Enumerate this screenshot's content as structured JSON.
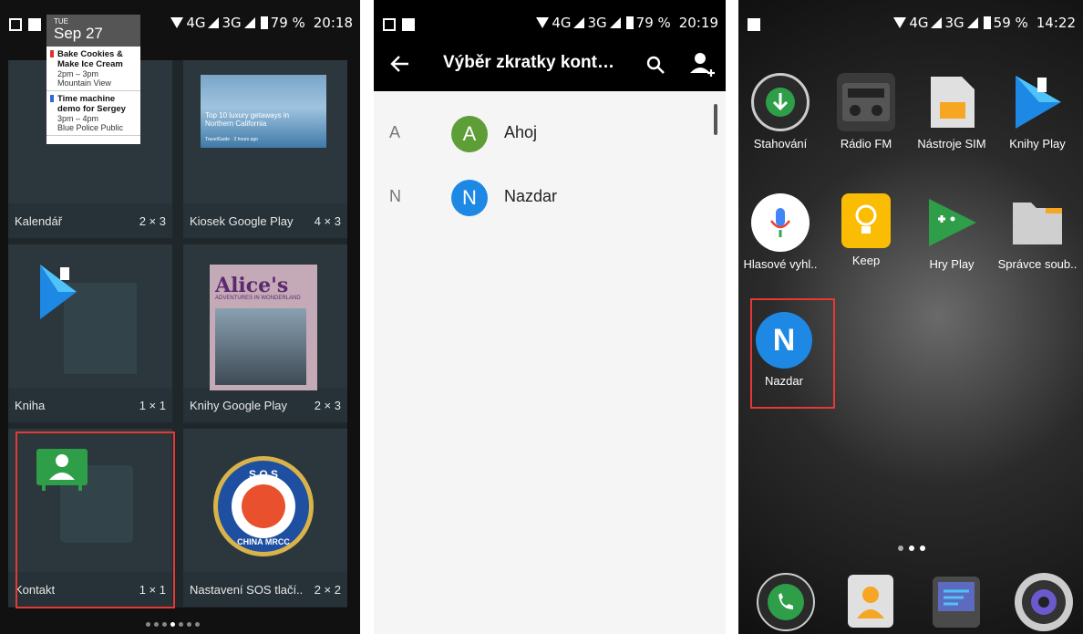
{
  "panel1": {
    "status": {
      "network": "4G",
      "network2": "3G",
      "battery": "79 %",
      "time": "20:18"
    },
    "calendar_preview": {
      "day": "TUE",
      "date": "Sep 27",
      "events": [
        {
          "title": "Bake Cookies & Make Ice Cream",
          "time": "2pm – 3pm",
          "place": "Mountain View"
        },
        {
          "title": "Time machine demo for Sergey",
          "time": "3pm – 4pm",
          "place": "Blue Police Public"
        }
      ]
    },
    "kiosk_preview": {
      "headline": "Top 10 luxury getaways in Northern California",
      "source": "TravelGuide · 3 hours ago"
    },
    "book_preview": {
      "title": "Alice's",
      "subtitle": "ADVENTURES IN WONDERLAND"
    },
    "sos_preview": {
      "top": "S O S",
      "bottom": "CHINA MRCC"
    },
    "widgets": [
      {
        "name": "Kalendář",
        "size": "2 × 3"
      },
      {
        "name": "Kiosek Google Play",
        "size": "4 × 3"
      },
      {
        "name": "Kniha",
        "size": "1 × 1"
      },
      {
        "name": "Knihy Google Play",
        "size": "2 × 3"
      },
      {
        "name": "Kontakt",
        "size": "1 × 1"
      },
      {
        "name": "Nastavení SOS tlačí..",
        "size": "2 × 2"
      }
    ]
  },
  "panel2": {
    "status": {
      "network": "4G",
      "network2": "3G",
      "battery": "79 %",
      "time": "20:19"
    },
    "title": "Výběr zkratky kont…",
    "contacts": [
      {
        "section": "A",
        "initial": "A",
        "name": "Ahoj",
        "color": "#5e9e37"
      },
      {
        "section": "N",
        "initial": "N",
        "name": "Nazdar",
        "color": "#1e88e5"
      }
    ]
  },
  "panel3": {
    "status": {
      "network": "4G",
      "network2": "3G",
      "battery": "59 %",
      "time": "14:22"
    },
    "apps": [
      {
        "name": "Stahování"
      },
      {
        "name": "Rádio FM"
      },
      {
        "name": "Nástroje SIM"
      },
      {
        "name": "Knihy Play"
      },
      {
        "name": "Hlasové vyhl.."
      },
      {
        "name": "Keep"
      },
      {
        "name": "Hry Play"
      },
      {
        "name": "Správce soub.."
      },
      {
        "name": "Nazdar",
        "initial": "N"
      }
    ]
  }
}
